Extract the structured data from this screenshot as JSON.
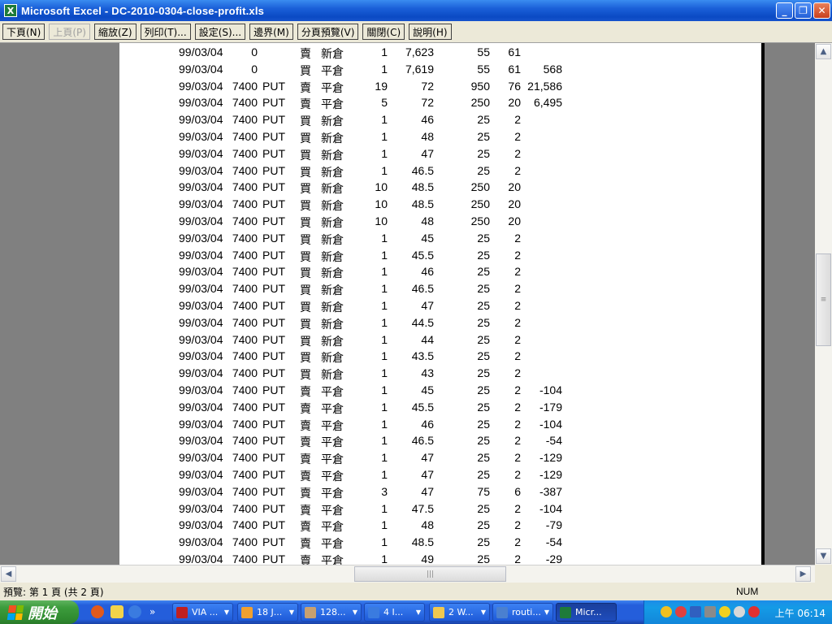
{
  "window": {
    "title": "Microsoft Excel - DC-2010-0304-close-profit.xls",
    "app_icon": "excel-icon",
    "buttons": {
      "minimize": "_",
      "maximize": "❐",
      "close": "✕"
    }
  },
  "toolbar": {
    "next": "下頁(N)",
    "prev": "上頁(P)",
    "zoom": "縮放(Z)",
    "print": "列印(T)...",
    "setup": "設定(S)...",
    "margins": "邊界(M)",
    "page_break": "分頁預覽(V)",
    "close": "關閉(C)",
    "help": "說明(H)"
  },
  "sheet": {
    "rows": [
      {
        "date": "99/03/04",
        "strike": "0",
        "type": "",
        "bs": "賣",
        "oc": "新倉",
        "qty": "1",
        "price": "7,623",
        "amount": "55",
        "fee": "61",
        "pl": ""
      },
      {
        "date": "99/03/04",
        "strike": "0",
        "type": "",
        "bs": "買",
        "oc": "平倉",
        "qty": "1",
        "price": "7,619",
        "amount": "55",
        "fee": "61",
        "pl": "568"
      },
      {
        "date": "99/03/04",
        "strike": "7400",
        "type": "PUT",
        "bs": "賣",
        "oc": "平倉",
        "qty": "19",
        "price": "72",
        "amount": "950",
        "fee": "76",
        "pl": "21,586"
      },
      {
        "date": "99/03/04",
        "strike": "7400",
        "type": "PUT",
        "bs": "賣",
        "oc": "平倉",
        "qty": "5",
        "price": "72",
        "amount": "250",
        "fee": "20",
        "pl": "6,495"
      },
      {
        "date": "99/03/04",
        "strike": "7400",
        "type": "PUT",
        "bs": "買",
        "oc": "新倉",
        "qty": "1",
        "price": "46",
        "amount": "25",
        "fee": "2",
        "pl": ""
      },
      {
        "date": "99/03/04",
        "strike": "7400",
        "type": "PUT",
        "bs": "買",
        "oc": "新倉",
        "qty": "1",
        "price": "48",
        "amount": "25",
        "fee": "2",
        "pl": ""
      },
      {
        "date": "99/03/04",
        "strike": "7400",
        "type": "PUT",
        "bs": "買",
        "oc": "新倉",
        "qty": "1",
        "price": "47",
        "amount": "25",
        "fee": "2",
        "pl": ""
      },
      {
        "date": "99/03/04",
        "strike": "7400",
        "type": "PUT",
        "bs": "買",
        "oc": "新倉",
        "qty": "1",
        "price": "46.5",
        "amount": "25",
        "fee": "2",
        "pl": ""
      },
      {
        "date": "99/03/04",
        "strike": "7400",
        "type": "PUT",
        "bs": "買",
        "oc": "新倉",
        "qty": "10",
        "price": "48.5",
        "amount": "250",
        "fee": "20",
        "pl": ""
      },
      {
        "date": "99/03/04",
        "strike": "7400",
        "type": "PUT",
        "bs": "買",
        "oc": "新倉",
        "qty": "10",
        "price": "48.5",
        "amount": "250",
        "fee": "20",
        "pl": ""
      },
      {
        "date": "99/03/04",
        "strike": "7400",
        "type": "PUT",
        "bs": "買",
        "oc": "新倉",
        "qty": "10",
        "price": "48",
        "amount": "250",
        "fee": "20",
        "pl": ""
      },
      {
        "date": "99/03/04",
        "strike": "7400",
        "type": "PUT",
        "bs": "買",
        "oc": "新倉",
        "qty": "1",
        "price": "45",
        "amount": "25",
        "fee": "2",
        "pl": ""
      },
      {
        "date": "99/03/04",
        "strike": "7400",
        "type": "PUT",
        "bs": "買",
        "oc": "新倉",
        "qty": "1",
        "price": "45.5",
        "amount": "25",
        "fee": "2",
        "pl": ""
      },
      {
        "date": "99/03/04",
        "strike": "7400",
        "type": "PUT",
        "bs": "買",
        "oc": "新倉",
        "qty": "1",
        "price": "46",
        "amount": "25",
        "fee": "2",
        "pl": ""
      },
      {
        "date": "99/03/04",
        "strike": "7400",
        "type": "PUT",
        "bs": "買",
        "oc": "新倉",
        "qty": "1",
        "price": "46.5",
        "amount": "25",
        "fee": "2",
        "pl": ""
      },
      {
        "date": "99/03/04",
        "strike": "7400",
        "type": "PUT",
        "bs": "買",
        "oc": "新倉",
        "qty": "1",
        "price": "47",
        "amount": "25",
        "fee": "2",
        "pl": ""
      },
      {
        "date": "99/03/04",
        "strike": "7400",
        "type": "PUT",
        "bs": "買",
        "oc": "新倉",
        "qty": "1",
        "price": "44.5",
        "amount": "25",
        "fee": "2",
        "pl": ""
      },
      {
        "date": "99/03/04",
        "strike": "7400",
        "type": "PUT",
        "bs": "買",
        "oc": "新倉",
        "qty": "1",
        "price": "44",
        "amount": "25",
        "fee": "2",
        "pl": ""
      },
      {
        "date": "99/03/04",
        "strike": "7400",
        "type": "PUT",
        "bs": "買",
        "oc": "新倉",
        "qty": "1",
        "price": "43.5",
        "amount": "25",
        "fee": "2",
        "pl": ""
      },
      {
        "date": "99/03/04",
        "strike": "7400",
        "type": "PUT",
        "bs": "買",
        "oc": "新倉",
        "qty": "1",
        "price": "43",
        "amount": "25",
        "fee": "2",
        "pl": ""
      },
      {
        "date": "99/03/04",
        "strike": "7400",
        "type": "PUT",
        "bs": "賣",
        "oc": "平倉",
        "qty": "1",
        "price": "45",
        "amount": "25",
        "fee": "2",
        "pl": "-104"
      },
      {
        "date": "99/03/04",
        "strike": "7400",
        "type": "PUT",
        "bs": "賣",
        "oc": "平倉",
        "qty": "1",
        "price": "45.5",
        "amount": "25",
        "fee": "2",
        "pl": "-179"
      },
      {
        "date": "99/03/04",
        "strike": "7400",
        "type": "PUT",
        "bs": "賣",
        "oc": "平倉",
        "qty": "1",
        "price": "46",
        "amount": "25",
        "fee": "2",
        "pl": "-104"
      },
      {
        "date": "99/03/04",
        "strike": "7400",
        "type": "PUT",
        "bs": "賣",
        "oc": "平倉",
        "qty": "1",
        "price": "46.5",
        "amount": "25",
        "fee": "2",
        "pl": "-54"
      },
      {
        "date": "99/03/04",
        "strike": "7400",
        "type": "PUT",
        "bs": "賣",
        "oc": "平倉",
        "qty": "1",
        "price": "47",
        "amount": "25",
        "fee": "2",
        "pl": "-129"
      },
      {
        "date": "99/03/04",
        "strike": "7400",
        "type": "PUT",
        "bs": "賣",
        "oc": "平倉",
        "qty": "1",
        "price": "47",
        "amount": "25",
        "fee": "2",
        "pl": "-129"
      },
      {
        "date": "99/03/04",
        "strike": "7400",
        "type": "PUT",
        "bs": "賣",
        "oc": "平倉",
        "qty": "3",
        "price": "47",
        "amount": "75",
        "fee": "6",
        "pl": "-387"
      },
      {
        "date": "99/03/04",
        "strike": "7400",
        "type": "PUT",
        "bs": "賣",
        "oc": "平倉",
        "qty": "1",
        "price": "47.5",
        "amount": "25",
        "fee": "2",
        "pl": "-104"
      },
      {
        "date": "99/03/04",
        "strike": "7400",
        "type": "PUT",
        "bs": "賣",
        "oc": "平倉",
        "qty": "1",
        "price": "48",
        "amount": "25",
        "fee": "2",
        "pl": "-79"
      },
      {
        "date": "99/03/04",
        "strike": "7400",
        "type": "PUT",
        "bs": "賣",
        "oc": "平倉",
        "qty": "1",
        "price": "48.5",
        "amount": "25",
        "fee": "2",
        "pl": "-54"
      },
      {
        "date": "99/03/04",
        "strike": "7400",
        "type": "PUT",
        "bs": "賣",
        "oc": "平倉",
        "qty": "1",
        "price": "49",
        "amount": "25",
        "fee": "2",
        "pl": "-29"
      }
    ]
  },
  "scrollbars": {
    "up": "▲",
    "down": "▼",
    "left": "◀",
    "right": "▶",
    "grip": "≡",
    "hgrip": "|||"
  },
  "statusbar": {
    "left": "預覽: 第 1 頁 (共 2 頁)",
    "num": "NUM"
  },
  "taskbar": {
    "start_label": "開始",
    "tasks": [
      {
        "label": "VIA ..."
      },
      {
        "label": "18 J..."
      },
      {
        "label": "128..."
      },
      {
        "label": "4 I..."
      },
      {
        "label": "2 W..."
      },
      {
        "label": "routi..."
      },
      {
        "label": "Micr..."
      }
    ],
    "clock": "上午 06:14"
  },
  "colors": {
    "titlebar": "#0b4ac4",
    "chrome": "#ece9d8",
    "taskbar": "#245edb",
    "start": "#3c9c3c",
    "tray": "#149be6",
    "preview_bg": "#808080"
  }
}
